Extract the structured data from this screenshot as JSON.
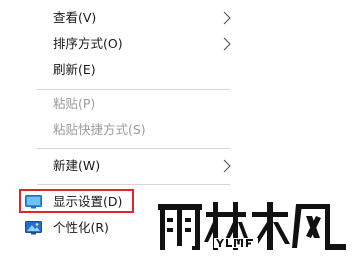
{
  "context_menu": {
    "items": [
      {
        "label": "查看(V)",
        "has_submenu": true,
        "disabled": false
      },
      {
        "label": "排序方式(O)",
        "has_submenu": true,
        "disabled": false
      },
      {
        "label": "刷新(E)",
        "has_submenu": false,
        "disabled": false
      },
      {
        "label": "粘贴(P)",
        "has_submenu": false,
        "disabled": true
      },
      {
        "label": "粘贴快捷方式(S)",
        "has_submenu": false,
        "disabled": true
      },
      {
        "label": "新建(W)",
        "has_submenu": true,
        "disabled": false
      },
      {
        "label": "显示设置(D)",
        "has_submenu": false,
        "disabled": false,
        "icon": "display-settings-icon",
        "highlighted": true
      },
      {
        "label": "个性化(R)",
        "has_submenu": false,
        "disabled": false,
        "icon": "personalize-icon"
      }
    ]
  },
  "highlight": {
    "color": "#e0252b",
    "target": "显示设置(D)"
  },
  "watermark": {
    "text": "雨林木风",
    "subtext": "YLMF"
  }
}
